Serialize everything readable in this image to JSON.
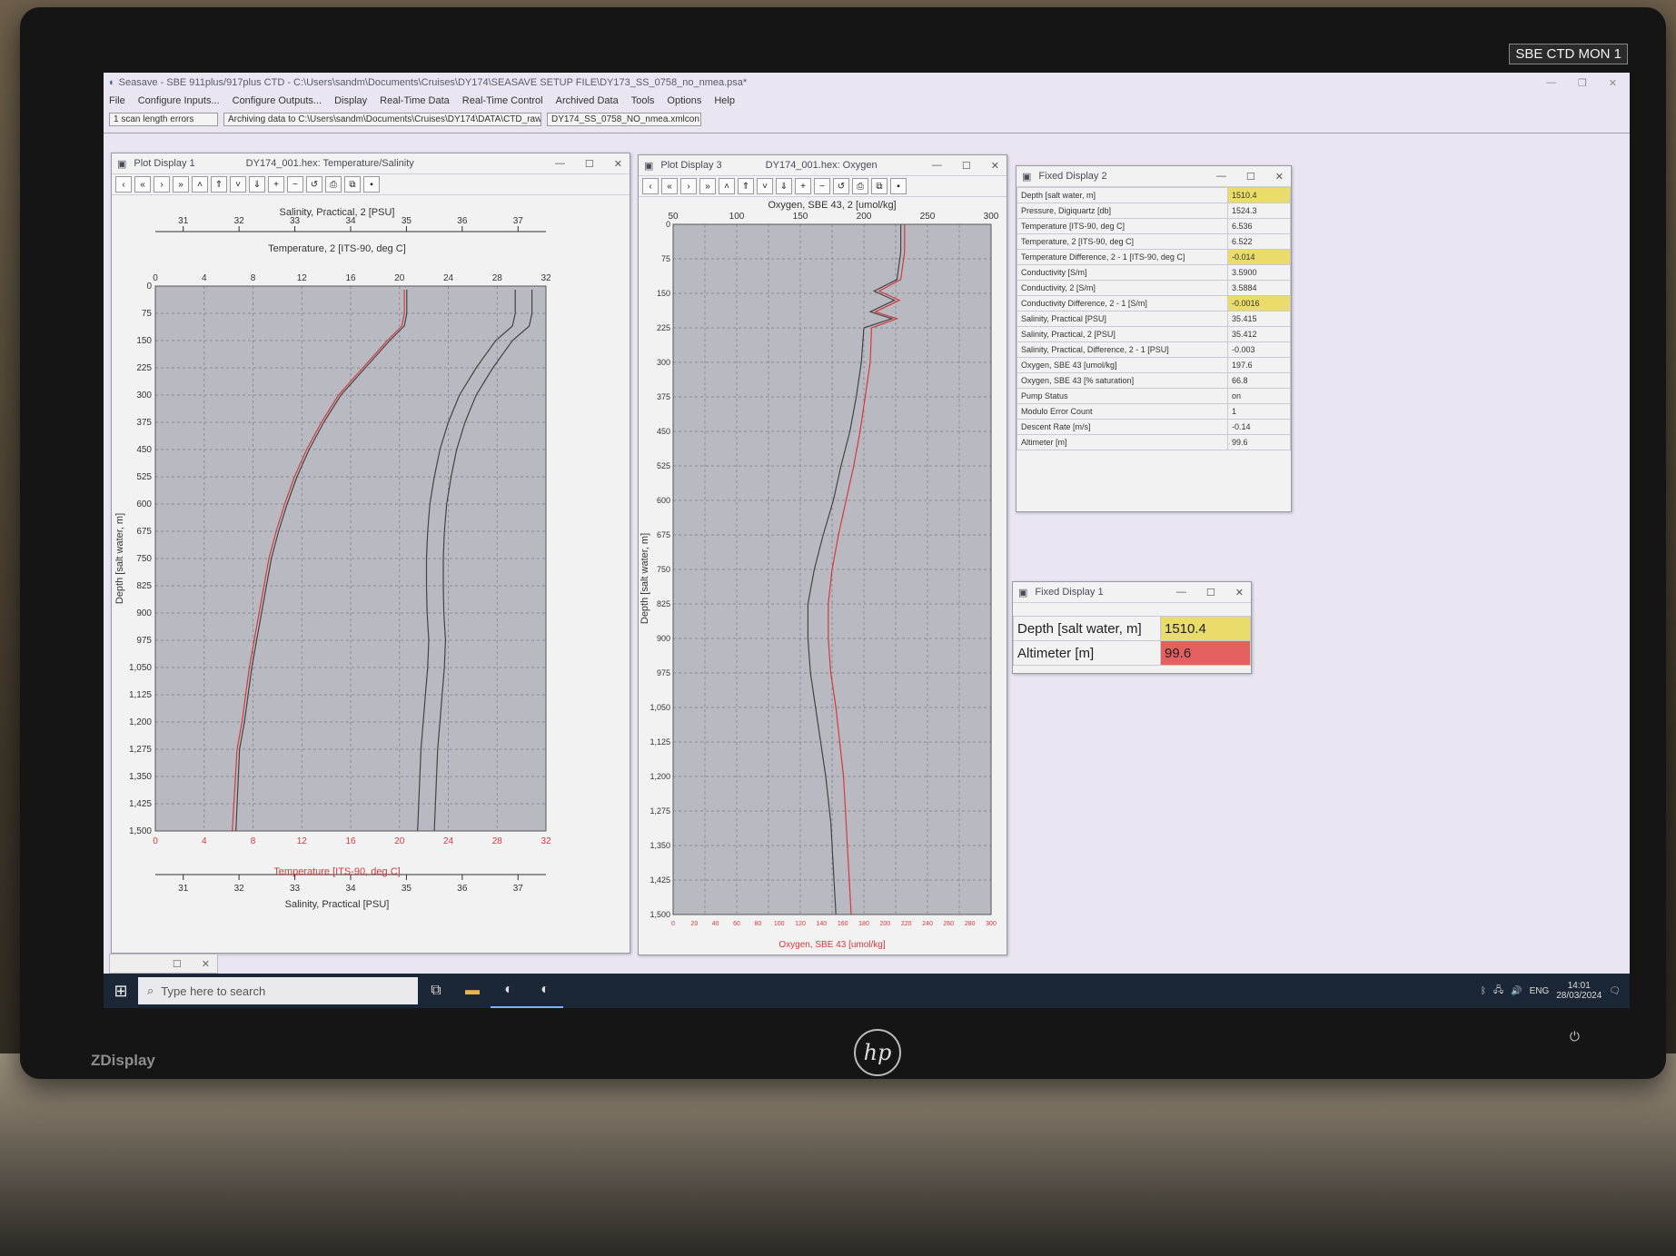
{
  "monitor": {
    "badge": "SBE CTD MON 1",
    "brand": "ZDisplay",
    "logo": "hp"
  },
  "app": {
    "title": "Seasave - SBE 911plus/917plus CTD - C:\\Users\\sandm\\Documents\\Cruises\\DY174\\SEASAVE SETUP FILE\\DY173_SS_0758_no_nmea.psa*",
    "menu": [
      "File",
      "Configure Inputs...",
      "Configure Outputs...",
      "Display",
      "Real-Time Data",
      "Real-Time Control",
      "Archived Data",
      "Tools",
      "Options",
      "Help"
    ],
    "status": {
      "errors": "1 scan length errors",
      "archiving": "Archiving data to C:\\Users\\sandm\\Documents\\Cruises\\DY174\\DATA\\CTD_raw",
      "config": "DY174_SS_0758_NO_nmea.xmlcon"
    }
  },
  "plot1": {
    "window_name": "Plot Display 1",
    "file_title": "DY174_001.hex: Temperature/Salinity",
    "top_axis_salinity_label": "Salinity, Practical, 2 [PSU]",
    "top_axis_temp_label": "Temperature, 2 [ITS-90, deg C]",
    "bottom_axis_temp_label": "Temperature [ITS-90, deg C]",
    "bottom_axis_salinity_label": "Salinity, Practical [PSU]",
    "y_label": "Depth [salt water, m]",
    "salinity_ticks": [
      "31",
      "32",
      "33",
      "34",
      "35",
      "36",
      "37"
    ],
    "temp_ticks": [
      "0",
      "4",
      "8",
      "12",
      "16",
      "20",
      "24",
      "28",
      "32"
    ],
    "depth_ticks": [
      "0",
      "75",
      "150",
      "225",
      "300",
      "375",
      "450",
      "525",
      "600",
      "675",
      "750",
      "825",
      "900",
      "975",
      "1,050",
      "1,125",
      "1,200",
      "1,275",
      "1,350",
      "1,425",
      "1,500"
    ]
  },
  "plot3": {
    "window_name": "Plot Display 3",
    "file_title": "DY174_001.hex: Oxygen",
    "top_axis_label": "Oxygen, SBE 43, 2 [umol/kg]",
    "bottom_axis_label": "Oxygen, SBE 43 [umol/kg]",
    "y_label": "Depth [salt water, m]",
    "oxygen_ticks_top": [
      "50",
      "100",
      "150",
      "200",
      "250",
      "300"
    ],
    "oxygen_ticks_bottom": [
      "0",
      "20",
      "40",
      "60",
      "80",
      "100",
      "120",
      "140",
      "160",
      "180",
      "200",
      "220",
      "240",
      "260",
      "280",
      "300"
    ],
    "depth_ticks": [
      "0",
      "75",
      "150",
      "225",
      "300",
      "375",
      "450",
      "525",
      "600",
      "675",
      "750",
      "825",
      "900",
      "975",
      "1,050",
      "1,125",
      "1,200",
      "1,275",
      "1,350",
      "1,425",
      "1,500"
    ]
  },
  "chart_data": [
    {
      "type": "line",
      "title": "DY174_001.hex: Temperature/Salinity",
      "ylabel": "Depth [salt water, m]",
      "ylim": [
        1500,
        0
      ],
      "x_temp_lim": [
        0,
        32
      ],
      "x_sal_lim": [
        30.5,
        37.5
      ],
      "series": [
        {
          "name": "Temperature, 2 [ITS-90, deg C]",
          "color": "#444444",
          "axis": "temp",
          "x": [
            20.6,
            20.6,
            20.4,
            19.2,
            17.2,
            15.2,
            13.8,
            12.6,
            11.6,
            10.8,
            10.1,
            9.5,
            9.1,
            8.7,
            8.3,
            7.9,
            7.6,
            7.3,
            6.9,
            6.6
          ],
          "y": [
            10,
            75,
            110,
            150,
            225,
            300,
            375,
            450,
            525,
            600,
            675,
            750,
            825,
            900,
            975,
            1050,
            1125,
            1200,
            1275,
            1500
          ]
        },
        {
          "name": "Temperature [ITS-90, deg C]",
          "color": "#d43a3a",
          "axis": "temp",
          "x": [
            20.4,
            20.4,
            20.2,
            19.0,
            17.0,
            15.0,
            13.6,
            12.4,
            11.4,
            10.6,
            9.9,
            9.3,
            8.9,
            8.5,
            8.1,
            7.7,
            7.4,
            7.1,
            6.7,
            6.3
          ],
          "y": [
            10,
            75,
            110,
            150,
            225,
            300,
            375,
            450,
            525,
            600,
            675,
            750,
            825,
            900,
            975,
            1050,
            1125,
            1200,
            1275,
            1500
          ]
        },
        {
          "name": "Salinity, Practical, 2 [PSU]",
          "color": "#444444",
          "axis": "sal",
          "x": [
            36.95,
            36.95,
            36.9,
            36.6,
            36.25,
            35.95,
            35.75,
            35.6,
            35.5,
            35.42,
            35.38,
            35.36,
            35.36,
            35.37,
            35.4,
            35.38,
            35.34,
            35.3,
            35.26,
            35.2
          ],
          "y": [
            10,
            75,
            110,
            150,
            225,
            300,
            375,
            450,
            525,
            600,
            675,
            750,
            825,
            900,
            975,
            1050,
            1125,
            1200,
            1275,
            1500
          ]
        },
        {
          "name": "Salinity, Practical [PSU]",
          "color": "#444444",
          "axis": "sal",
          "x": [
            37.25,
            37.25,
            37.2,
            36.9,
            36.55,
            36.25,
            36.05,
            35.9,
            35.8,
            35.72,
            35.68,
            35.66,
            35.66,
            35.67,
            35.7,
            35.68,
            35.64,
            35.6,
            35.56,
            35.5
          ],
          "y": [
            10,
            75,
            110,
            150,
            225,
            300,
            375,
            450,
            525,
            600,
            675,
            750,
            825,
            900,
            975,
            1050,
            1125,
            1200,
            1275,
            1500
          ]
        }
      ]
    },
    {
      "type": "line",
      "title": "DY174_001.hex: Oxygen",
      "ylabel": "Depth [salt water, m]",
      "ylim": [
        1500,
        0
      ],
      "xlim": [
        50,
        300
      ],
      "series": [
        {
          "name": "Oxygen, SBE 43, 2 [umol/kg]",
          "color": "#444444",
          "x": [
            229,
            229,
            226,
            208,
            224,
            205,
            222,
            200,
            198,
            194,
            189,
            182,
            176,
            168,
            161,
            156,
            156,
            158,
            162,
            166,
            170,
            174,
            178
          ],
          "y": [
            0,
            60,
            120,
            145,
            165,
            190,
            205,
            225,
            300,
            375,
            450,
            525,
            600,
            675,
            750,
            825,
            900,
            975,
            1050,
            1125,
            1200,
            1300,
            1500
          ]
        },
        {
          "name": "Oxygen, SBE 43 [umol/kg]",
          "color": "#d43a3a",
          "x": [
            232,
            232,
            229,
            212,
            228,
            209,
            226,
            206,
            205,
            201,
            197,
            192,
            186,
            180,
            175,
            172,
            172,
            174,
            178,
            181,
            184,
            186,
            190
          ],
          "y": [
            0,
            60,
            120,
            145,
            165,
            190,
            205,
            225,
            300,
            375,
            450,
            525,
            600,
            675,
            750,
            825,
            900,
            975,
            1050,
            1125,
            1200,
            1300,
            1500
          ]
        }
      ]
    }
  ],
  "fixed2": {
    "window_name": "Fixed Display 2",
    "rows": [
      {
        "label": "Depth [salt water, m]",
        "value": "1510.4",
        "highlight": "#e9dc6a"
      },
      {
        "label": "Pressure, Digiquartz [db]",
        "value": "1524.3",
        "highlight": ""
      },
      {
        "label": "Temperature [ITS-90, deg C]",
        "value": "6.536",
        "highlight": ""
      },
      {
        "label": "Temperature, 2 [ITS-90, deg C]",
        "value": "6.522",
        "highlight": ""
      },
      {
        "label": "Temperature Difference, 2 - 1 [ITS-90, deg C]",
        "value": "-0.014",
        "highlight": "#e9dc6a"
      },
      {
        "label": "Conductivity [S/m]",
        "value": "3.5900",
        "highlight": ""
      },
      {
        "label": "Conductivity, 2 [S/m]",
        "value": "3.5884",
        "highlight": ""
      },
      {
        "label": "Conductivity Difference, 2 - 1 [S/m]",
        "value": "-0.0016",
        "highlight": "#e9dc6a"
      },
      {
        "label": "Salinity, Practical [PSU]",
        "value": "35.415",
        "highlight": ""
      },
      {
        "label": "Salinity, Practical, 2 [PSU]",
        "value": "35.412",
        "highlight": ""
      },
      {
        "label": "Salinity, Practical, Difference, 2 - 1 [PSU]",
        "value": "-0.003",
        "highlight": ""
      },
      {
        "label": "Oxygen, SBE 43 [umol/kg]",
        "value": "197.6",
        "highlight": ""
      },
      {
        "label": "Oxygen, SBE 43 [% saturation]",
        "value": "66.8",
        "highlight": ""
      },
      {
        "label": "Pump Status",
        "value": "on",
        "highlight": ""
      },
      {
        "label": "Modulo Error Count",
        "value": "1",
        "highlight": ""
      },
      {
        "label": "Descent Rate [m/s]",
        "value": "-0.14",
        "highlight": ""
      },
      {
        "label": "Altimeter [m]",
        "value": "99.6",
        "highlight": ""
      }
    ]
  },
  "fixed1": {
    "window_name": "Fixed Display 1",
    "rows": [
      {
        "label": "Depth [salt water, m]",
        "value": "1510.4",
        "highlight": "#e9dc6a"
      },
      {
        "label": "Altimeter [m]",
        "value": "99.6",
        "highlight": "#e46060"
      }
    ]
  },
  "taskbar": {
    "search_placeholder": "Type here to search",
    "lang": "ENG",
    "time": "14:01",
    "date": "28/03/2024"
  },
  "colors": {
    "plot_bg": "#b9b9c2",
    "grid": "#8c8c96",
    "accent_yellow": "#e9dc6a",
    "accent_red": "#e46060"
  }
}
